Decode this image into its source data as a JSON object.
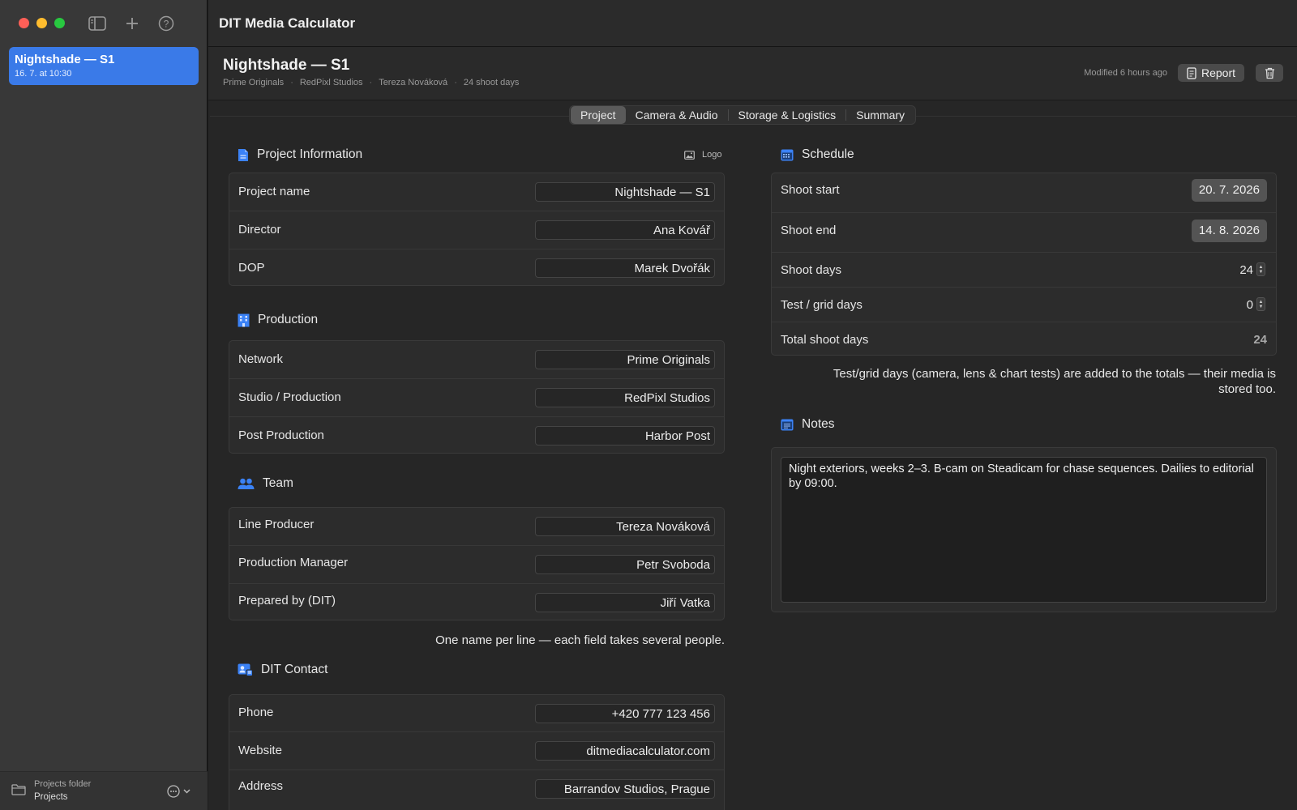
{
  "sidebar": {
    "project": {
      "name": "Nightshade — S1",
      "date": "16. 7. at 10:30"
    },
    "footer": {
      "label": "Projects folder",
      "value": "Projects"
    },
    "icons": [
      "sidebar-toggle-icon",
      "plus-icon",
      "help-icon",
      "folder-icon",
      "ellipsis-icon",
      "chevron-down-icon"
    ]
  },
  "app": {
    "title": "DIT Media Calculator"
  },
  "header": {
    "title": "Nightshade — S1",
    "meta": [
      "Prime Originals",
      "RedPixl Studios",
      "Tereza Nováková",
      "24 shoot days"
    ],
    "modified": "Modified 6 hours ago",
    "report_label": "Report"
  },
  "tabs": [
    "Project",
    "Camera & Audio",
    "Storage & Logistics",
    "Summary"
  ],
  "active_tab": "Project",
  "project_info": {
    "title": "Project Information",
    "logo_label": "Logo",
    "rows": [
      {
        "label": "Project name",
        "value": "Nightshade — S1"
      },
      {
        "label": "Director",
        "value": "Ana Kovář"
      },
      {
        "label": "DOP",
        "value": "Marek Dvořák"
      }
    ]
  },
  "production": {
    "title": "Production",
    "rows": [
      {
        "label": "Network",
        "value": "Prime Originals"
      },
      {
        "label": "Studio / Production",
        "value": "RedPixl Studios"
      },
      {
        "label": "Post Production",
        "value": "Harbor Post"
      }
    ]
  },
  "team": {
    "title": "Team",
    "rows": [
      {
        "label": "Line Producer",
        "value": "Tereza Nováková"
      },
      {
        "label": "Production Manager",
        "value": "Petr Svoboda"
      },
      {
        "label": "Prepared by (DIT)",
        "value": "Jiří Vatka"
      }
    ],
    "hint": "One name per line — each field takes several people."
  },
  "dit_contact": {
    "title": "DIT Contact",
    "rows": [
      {
        "label": "Phone",
        "value": "+420 777 123 456"
      },
      {
        "label": "Website",
        "value": "ditmediacalculator.com"
      },
      {
        "label": "Address",
        "value": "Barrandov Studios, Prague"
      }
    ]
  },
  "schedule": {
    "title": "Schedule",
    "shoot_start_label": "Shoot start",
    "shoot_start": "20. 7. 2026",
    "shoot_end_label": "Shoot end",
    "shoot_end": "14. 8. 2026",
    "shoot_days_label": "Shoot days",
    "shoot_days": "24",
    "test_days_label": "Test / grid days",
    "test_days": "0",
    "total_label": "Total shoot days",
    "total": "24",
    "hint_line1": "Test/grid days (camera, lens & chart tests) are added to the totals — their media is",
    "hint_line2": "stored too."
  },
  "notes": {
    "title": "Notes",
    "text": "Night exteriors, weeks 2–3. B-cam on Steadicam for chase sequences. Dailies to editorial by 09:00."
  },
  "colors": {
    "accent": "#3a7ae8",
    "icon_blue": "#3b82f6"
  }
}
